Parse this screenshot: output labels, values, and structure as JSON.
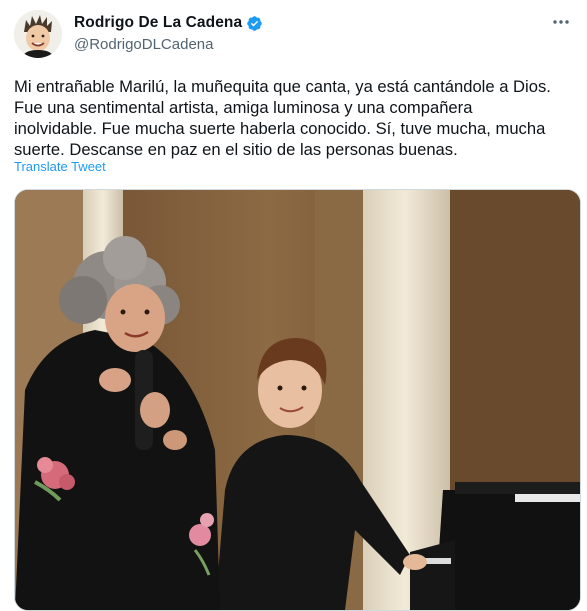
{
  "author": {
    "display_name": "Rodrigo De La Cadena",
    "handle": "@RodrigoDLCadena",
    "verified": true,
    "verified_color": "#1d9bf0"
  },
  "tweet": {
    "text_lines": [
      "Mi entrañable Marilú, la muñequita que canta, ya está cantándole a Dios.",
      "Fue una sentimental artista, amiga luminosa y una compañera",
      "inolvidable. Fue mucha suerte haberla conocido. Sí, tuve mucha, mucha",
      "suerte. Descanse en paz en el sitio de las personas buenas."
    ],
    "translate_label": "Translate Tweet"
  },
  "icons": {
    "more": "more-options-icon",
    "verified": "verified-badge-icon"
  },
  "colors": {
    "text": "#0f1419",
    "secondary": "#536471",
    "link": "#1d9bf0"
  }
}
